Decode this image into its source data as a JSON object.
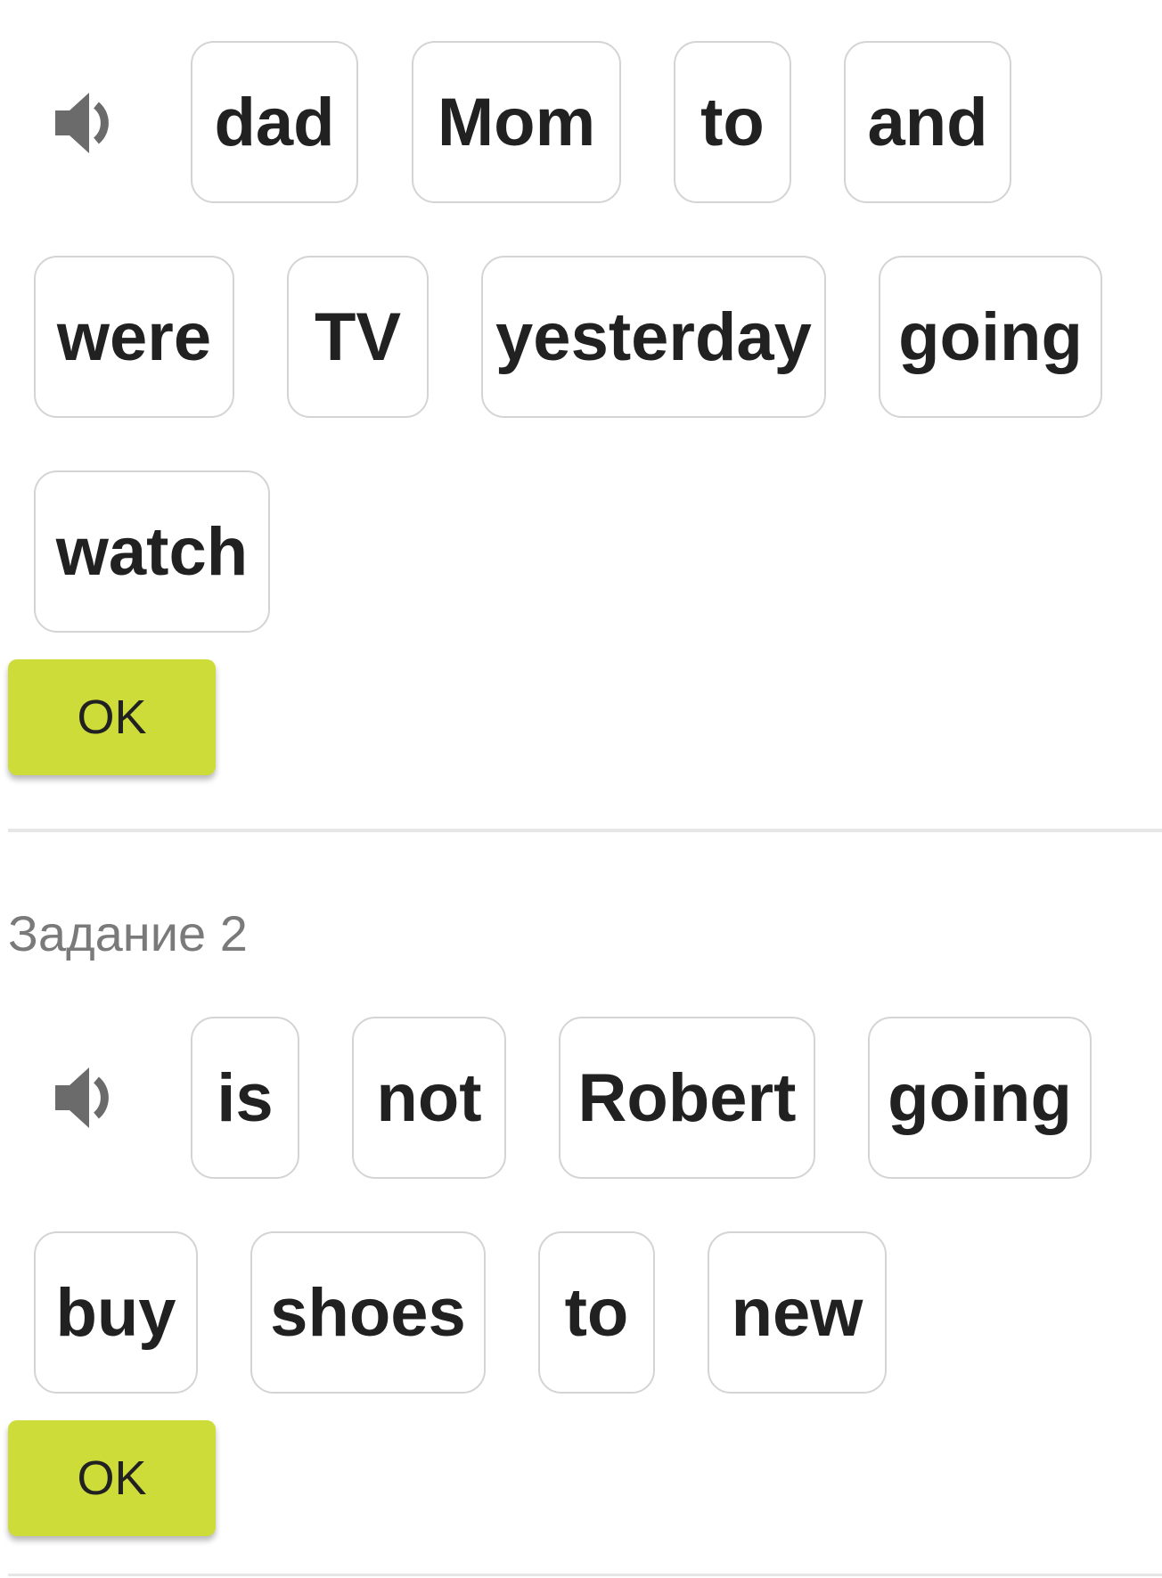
{
  "task1": {
    "speaker_icon": "speaker-volume-icon",
    "words": [
      "dad",
      "Mom",
      "to",
      "and",
      "were",
      "TV",
      "yesterday",
      "going",
      "watch"
    ],
    "ok_label": "OK"
  },
  "task2": {
    "title": "Задание 2",
    "speaker_icon": "speaker-volume-icon",
    "words": [
      "is",
      "not",
      "Robert",
      "going",
      "buy",
      "shoes",
      "to",
      "new"
    ],
    "ok_label": "OK"
  },
  "colors": {
    "ok_button": "#cddc39",
    "chip_border": "#d4d4d4",
    "title_text": "#7a7a7a",
    "speaker": "#6b6b6b"
  }
}
